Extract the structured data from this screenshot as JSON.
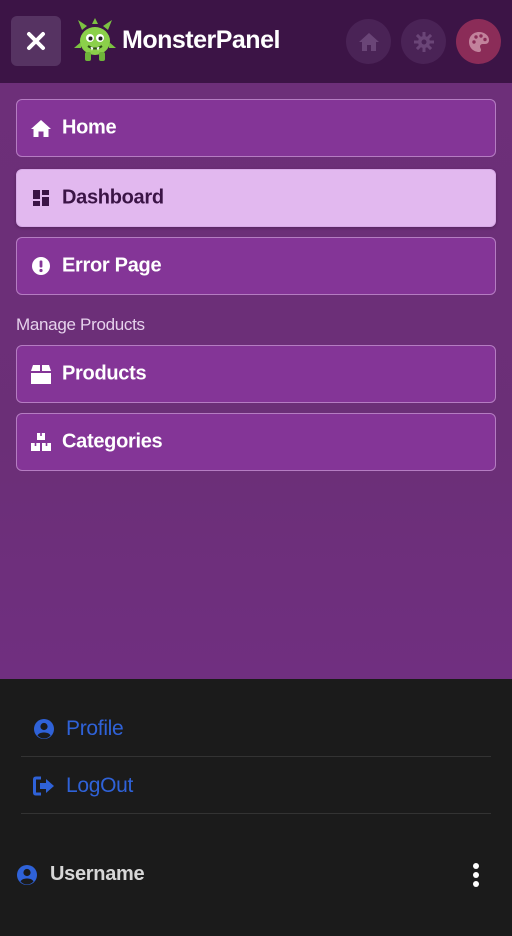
{
  "header": {
    "brand": "MonsterPanel",
    "close_icon": "close-icon",
    "home_icon": "home-icon",
    "settings_icon": "gear-icon",
    "theme_icon": "palette-icon",
    "accent_color": "#3c1446"
  },
  "menu": {
    "items": [
      {
        "label": "Home",
        "icon": "home-icon"
      },
      {
        "label": "Dashboard",
        "icon": "dashboard-icon",
        "active": true
      },
      {
        "label": "Error Page",
        "icon": "exclamation-circle-icon"
      }
    ],
    "section_label": "Manage Products",
    "section_items": [
      {
        "label": "Products",
        "icon": "box-icon"
      },
      {
        "label": "Categories",
        "icon": "cubes-icon"
      }
    ]
  },
  "footer": {
    "links": [
      {
        "label": "Profile",
        "icon": "user-circle-icon"
      },
      {
        "label": "LogOut",
        "icon": "sign-out-icon"
      }
    ],
    "username": "Username",
    "link_color": "#2f62d8"
  }
}
